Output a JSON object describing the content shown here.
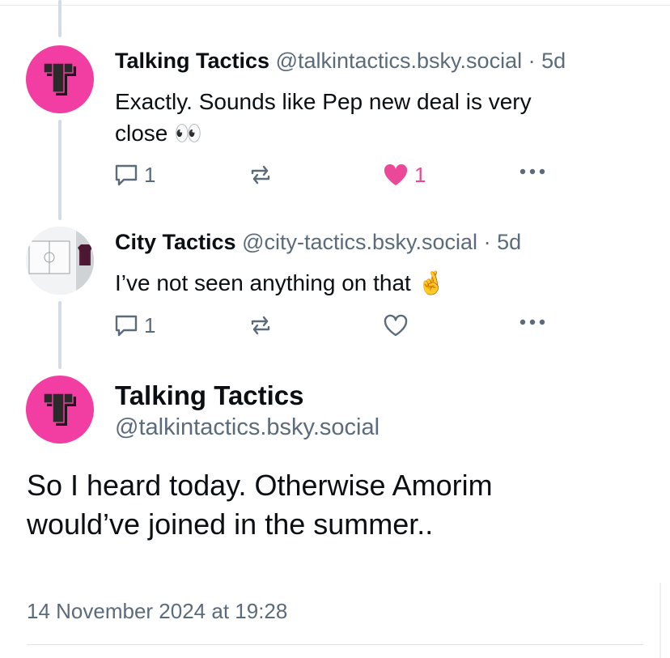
{
  "thread": [
    {
      "author_name": "Talking Tactics",
      "handle": "@talkintactics.bsky.social",
      "separator": "·",
      "time": "5d",
      "text_line1": "Exactly. Sounds like Pep new deal is very",
      "text_line2": "close",
      "emoji": "👀",
      "reply_count": "1",
      "like_count": "1",
      "liked": true,
      "avatar_letter": "T"
    },
    {
      "author_name": "City Tactics",
      "handle": "@city-tactics.bsky.social",
      "separator": "·",
      "time": "5d",
      "text_line1": "I’ve not seen anything on that",
      "emoji": "🤞",
      "reply_count": "1",
      "like_count": "",
      "liked": false
    }
  ],
  "focused_post": {
    "author_name": "Talking Tactics",
    "handle": "@talkintactics.bsky.social",
    "text": "So I heard today. Otherwise Amorim would’ve joined in the summer..",
    "timestamp": "14 November 2024 at 19:28",
    "avatar_letter": "T"
  },
  "colors": {
    "brand_pink": "#f23da2",
    "like_pink": "#ec4899",
    "muted_text": "#5b6b7c",
    "thread_line": "#d4dbe2"
  },
  "icons": [
    "reply-icon",
    "repost-icon",
    "heart-icon",
    "more-icon"
  ]
}
